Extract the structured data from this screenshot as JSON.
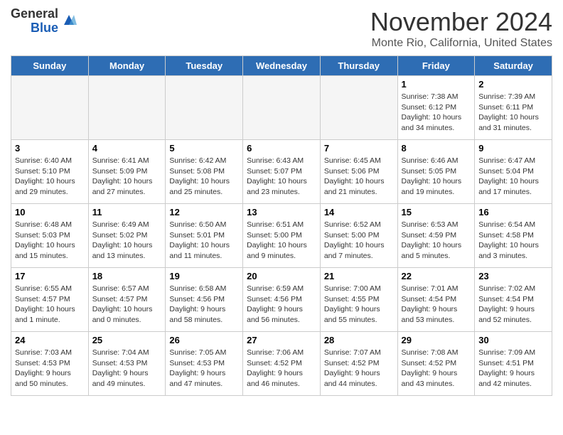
{
  "header": {
    "logo_line1": "General",
    "logo_line2": "Blue",
    "month": "November 2024",
    "location": "Monte Rio, California, United States"
  },
  "days_of_week": [
    "Sunday",
    "Monday",
    "Tuesday",
    "Wednesday",
    "Thursday",
    "Friday",
    "Saturday"
  ],
  "weeks": [
    [
      {
        "day": "",
        "info": ""
      },
      {
        "day": "",
        "info": ""
      },
      {
        "day": "",
        "info": ""
      },
      {
        "day": "",
        "info": ""
      },
      {
        "day": "",
        "info": ""
      },
      {
        "day": "1",
        "info": "Sunrise: 7:38 AM\nSunset: 6:12 PM\nDaylight: 10 hours\nand 34 minutes."
      },
      {
        "day": "2",
        "info": "Sunrise: 7:39 AM\nSunset: 6:11 PM\nDaylight: 10 hours\nand 31 minutes."
      }
    ],
    [
      {
        "day": "3",
        "info": "Sunrise: 6:40 AM\nSunset: 5:10 PM\nDaylight: 10 hours\nand 29 minutes."
      },
      {
        "day": "4",
        "info": "Sunrise: 6:41 AM\nSunset: 5:09 PM\nDaylight: 10 hours\nand 27 minutes."
      },
      {
        "day": "5",
        "info": "Sunrise: 6:42 AM\nSunset: 5:08 PM\nDaylight: 10 hours\nand 25 minutes."
      },
      {
        "day": "6",
        "info": "Sunrise: 6:43 AM\nSunset: 5:07 PM\nDaylight: 10 hours\nand 23 minutes."
      },
      {
        "day": "7",
        "info": "Sunrise: 6:45 AM\nSunset: 5:06 PM\nDaylight: 10 hours\nand 21 minutes."
      },
      {
        "day": "8",
        "info": "Sunrise: 6:46 AM\nSunset: 5:05 PM\nDaylight: 10 hours\nand 19 minutes."
      },
      {
        "day": "9",
        "info": "Sunrise: 6:47 AM\nSunset: 5:04 PM\nDaylight: 10 hours\nand 17 minutes."
      }
    ],
    [
      {
        "day": "10",
        "info": "Sunrise: 6:48 AM\nSunset: 5:03 PM\nDaylight: 10 hours\nand 15 minutes."
      },
      {
        "day": "11",
        "info": "Sunrise: 6:49 AM\nSunset: 5:02 PM\nDaylight: 10 hours\nand 13 minutes."
      },
      {
        "day": "12",
        "info": "Sunrise: 6:50 AM\nSunset: 5:01 PM\nDaylight: 10 hours\nand 11 minutes."
      },
      {
        "day": "13",
        "info": "Sunrise: 6:51 AM\nSunset: 5:00 PM\nDaylight: 10 hours\nand 9 minutes."
      },
      {
        "day": "14",
        "info": "Sunrise: 6:52 AM\nSunset: 5:00 PM\nDaylight: 10 hours\nand 7 minutes."
      },
      {
        "day": "15",
        "info": "Sunrise: 6:53 AM\nSunset: 4:59 PM\nDaylight: 10 hours\nand 5 minutes."
      },
      {
        "day": "16",
        "info": "Sunrise: 6:54 AM\nSunset: 4:58 PM\nDaylight: 10 hours\nand 3 minutes."
      }
    ],
    [
      {
        "day": "17",
        "info": "Sunrise: 6:55 AM\nSunset: 4:57 PM\nDaylight: 10 hours\nand 1 minute."
      },
      {
        "day": "18",
        "info": "Sunrise: 6:57 AM\nSunset: 4:57 PM\nDaylight: 10 hours\nand 0 minutes."
      },
      {
        "day": "19",
        "info": "Sunrise: 6:58 AM\nSunset: 4:56 PM\nDaylight: 9 hours\nand 58 minutes."
      },
      {
        "day": "20",
        "info": "Sunrise: 6:59 AM\nSunset: 4:56 PM\nDaylight: 9 hours\nand 56 minutes."
      },
      {
        "day": "21",
        "info": "Sunrise: 7:00 AM\nSunset: 4:55 PM\nDaylight: 9 hours\nand 55 minutes."
      },
      {
        "day": "22",
        "info": "Sunrise: 7:01 AM\nSunset: 4:54 PM\nDaylight: 9 hours\nand 53 minutes."
      },
      {
        "day": "23",
        "info": "Sunrise: 7:02 AM\nSunset: 4:54 PM\nDaylight: 9 hours\nand 52 minutes."
      }
    ],
    [
      {
        "day": "24",
        "info": "Sunrise: 7:03 AM\nSunset: 4:53 PM\nDaylight: 9 hours\nand 50 minutes."
      },
      {
        "day": "25",
        "info": "Sunrise: 7:04 AM\nSunset: 4:53 PM\nDaylight: 9 hours\nand 49 minutes."
      },
      {
        "day": "26",
        "info": "Sunrise: 7:05 AM\nSunset: 4:53 PM\nDaylight: 9 hours\nand 47 minutes."
      },
      {
        "day": "27",
        "info": "Sunrise: 7:06 AM\nSunset: 4:52 PM\nDaylight: 9 hours\nand 46 minutes."
      },
      {
        "day": "28",
        "info": "Sunrise: 7:07 AM\nSunset: 4:52 PM\nDaylight: 9 hours\nand 44 minutes."
      },
      {
        "day": "29",
        "info": "Sunrise: 7:08 AM\nSunset: 4:52 PM\nDaylight: 9 hours\nand 43 minutes."
      },
      {
        "day": "30",
        "info": "Sunrise: 7:09 AM\nSunset: 4:51 PM\nDaylight: 9 hours\nand 42 minutes."
      }
    ]
  ]
}
